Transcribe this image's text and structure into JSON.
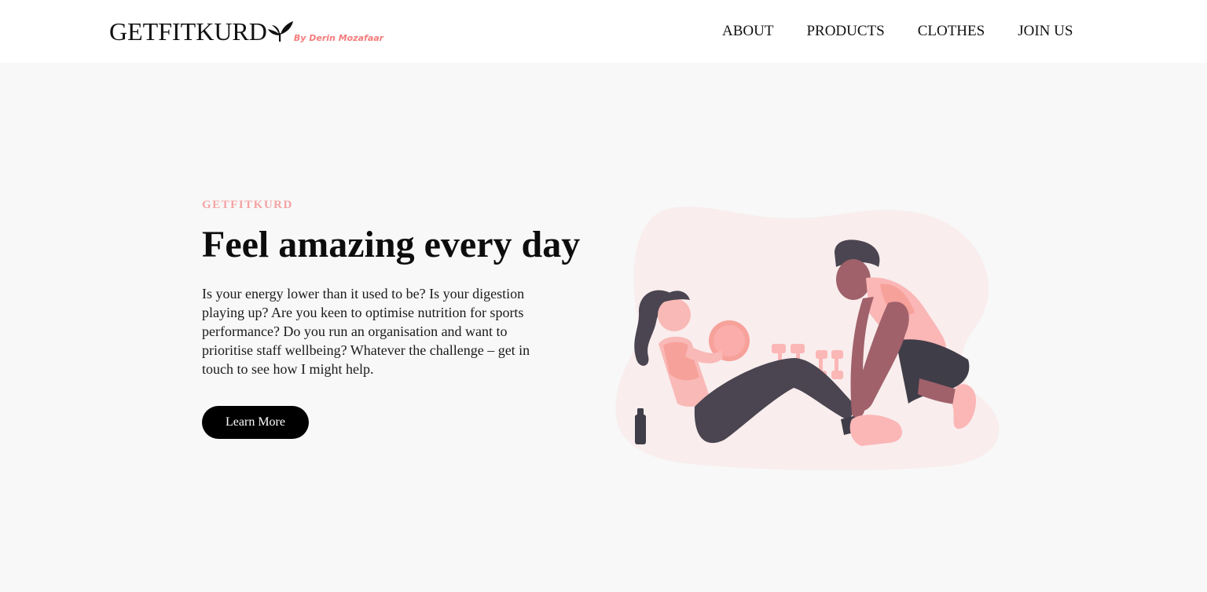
{
  "header": {
    "brand": "GETFITKURD",
    "byline": "By Derin Mozafaar",
    "nav": [
      "ABOUT",
      "PRODUCTS",
      "CLOTHES",
      "JOIN US"
    ]
  },
  "hero": {
    "eyebrow": "GETFITKURD",
    "title": "Feel amazing every day",
    "description": "Is your energy lower than it used to be? Is your digestion playing up? Are you keen to optimise nutrition for sports performance? Do you run an organisation and want to prioritise staff wellbeing? Whatever the challenge – get in touch to see how I might help.",
    "cta_label": "Learn More"
  },
  "illustration": {
    "name": "fitness-workout-illustration"
  },
  "colors": {
    "accent": "#f5a3a3",
    "accent_dark": "#f47c7c",
    "dark": "#000000",
    "figure_dark": "#4a4550",
    "skin_dark": "#a0616a",
    "blob": "#f9eded",
    "page_bg": "#f8f8f8"
  }
}
